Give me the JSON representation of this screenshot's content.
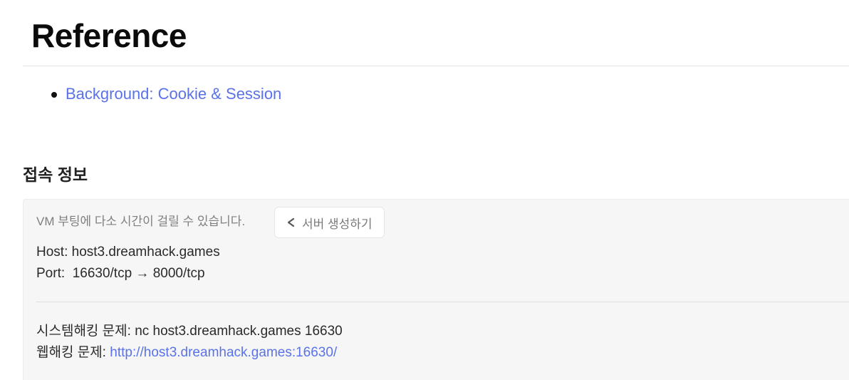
{
  "reference": {
    "title": "Reference",
    "links": [
      {
        "label": "Background: Cookie & Session"
      }
    ]
  },
  "connection": {
    "title": "접속 정보",
    "vm_note": "VM 부팅에 다소 시간이 걸릴 수 있습니다.",
    "create_server_button": {
      "label": "서버 생성하기",
      "icon": "share-icon"
    },
    "host_label": "Host:",
    "host_value": "host3.dreamhack.games",
    "port_label": "Port:",
    "port_value": "16630/tcp → 8000/tcp",
    "system_hacking_label": "시스템해킹 문제:",
    "system_hacking_command": "nc host3.dreamhack.games 16630",
    "web_hacking_label": "웹해킹 문제:",
    "web_hacking_url": "http://host3.dreamhack.games:16630/"
  },
  "colors": {
    "link": "#5a72e8",
    "box_background": "#f6f6f6",
    "muted_text": "#808080"
  }
}
